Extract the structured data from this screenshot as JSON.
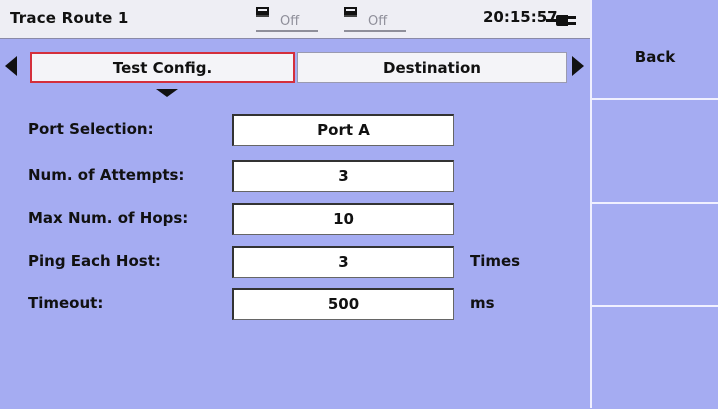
{
  "header": {
    "title": "Trace Route 1",
    "port1_state": "Off",
    "port2_state": "Off",
    "time": "20:15:57"
  },
  "tabs": [
    {
      "label": "Test Config.",
      "active": true
    },
    {
      "label": "Destination",
      "active": false
    }
  ],
  "form": {
    "port_selection": {
      "label": "Port Selection:",
      "value": "Port A"
    },
    "num_attempts": {
      "label": "Num. of Attempts:",
      "value": "3"
    },
    "max_hops": {
      "label": "Max Num. of Hops:",
      "value": "10"
    },
    "ping_each_host": {
      "label": "Ping Each Host:",
      "value": "3",
      "unit": "Times"
    },
    "timeout": {
      "label": "Timeout:",
      "value": "500",
      "unit": "ms"
    }
  },
  "softkeys": [
    "Back",
    "",
    "",
    ""
  ],
  "colors": {
    "background": "#a5acf2",
    "active_tab_border": "#d42f3c",
    "field_bg": "#ffffff"
  }
}
